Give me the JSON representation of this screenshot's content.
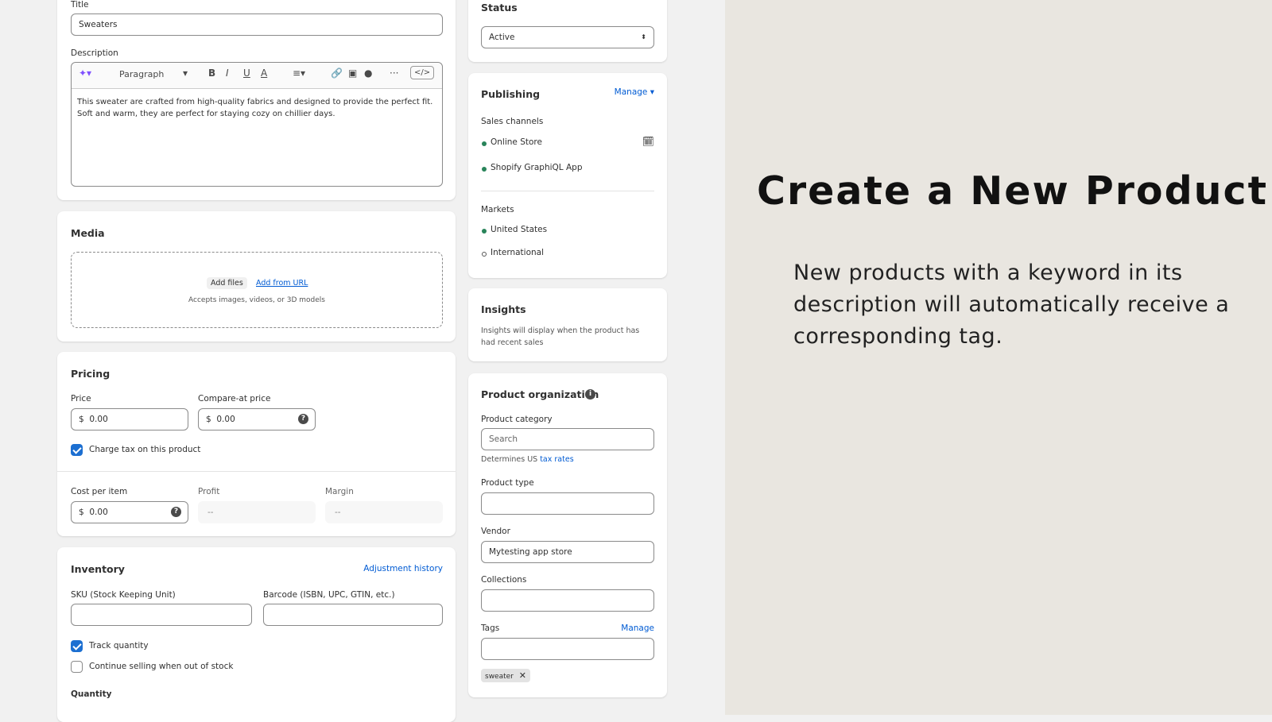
{
  "product": {
    "title_label": "Title",
    "title_value": "Sweaters",
    "description_label": "Description",
    "toolbar": {
      "format": "Paragraph",
      "bold": "B",
      "italic": "I",
      "underline": "U",
      "color": "A",
      "code": "</>",
      "more": "···"
    },
    "description_text": "This sweater are crafted from high-quality fabrics and designed to provide the perfect fit. Soft and warm, they are perfect for staying cozy on chillier days."
  },
  "media": {
    "heading": "Media",
    "add_files": "Add files",
    "add_url": "Add from URL",
    "hint": "Accepts images, videos, or 3D models"
  },
  "pricing": {
    "heading": "Pricing",
    "price_label": "Price",
    "price_value": "0.00",
    "compare_label": "Compare-at price",
    "compare_value": "0.00",
    "currency": "$",
    "charge_tax": "Charge tax on this product",
    "charge_tax_checked": true,
    "cost_label": "Cost per item",
    "cost_value": "0.00",
    "profit_label": "Profit",
    "profit_value": "--",
    "margin_label": "Margin",
    "margin_value": "--"
  },
  "inventory": {
    "heading": "Inventory",
    "adjustment_history": "Adjustment history",
    "sku_label": "SKU (Stock Keeping Unit)",
    "barcode_label": "Barcode (ISBN, UPC, GTIN, etc.)",
    "track_quantity": "Track quantity",
    "track_checked": true,
    "continue_selling": "Continue selling when out of stock",
    "continue_checked": false,
    "quantity_label": "Quantity"
  },
  "status": {
    "heading": "Status",
    "value": "Active"
  },
  "publishing": {
    "heading": "Publishing",
    "manage": "Manage",
    "sales_channels_label": "Sales channels",
    "channels": [
      "Online Store",
      "Shopify GraphiQL App"
    ],
    "markets_label": "Markets",
    "markets": [
      {
        "name": "United States",
        "active": true
      },
      {
        "name": "International",
        "active": false
      }
    ]
  },
  "insights": {
    "heading": "Insights",
    "text": "Insights will display when the product has had recent sales"
  },
  "organization": {
    "heading": "Product organization",
    "category_label": "Product category",
    "category_placeholder": "Search",
    "tax_hint_prefix": "Determines US ",
    "tax_hint_link": "tax rates",
    "type_label": "Product type",
    "vendor_label": "Vendor",
    "vendor_value": "Mytesting app store",
    "collections_label": "Collections",
    "tags_label": "Tags",
    "tags_manage": "Manage",
    "tags": [
      "sweater"
    ]
  },
  "promo": {
    "title": "Create a New Product",
    "subtitle": "New products with a keyword in its description will automatically receive a corresponding tag."
  },
  "colors": {
    "accent": "#005bd3",
    "active_dot": "#29845a",
    "right_bg": "#e9e6e0"
  }
}
